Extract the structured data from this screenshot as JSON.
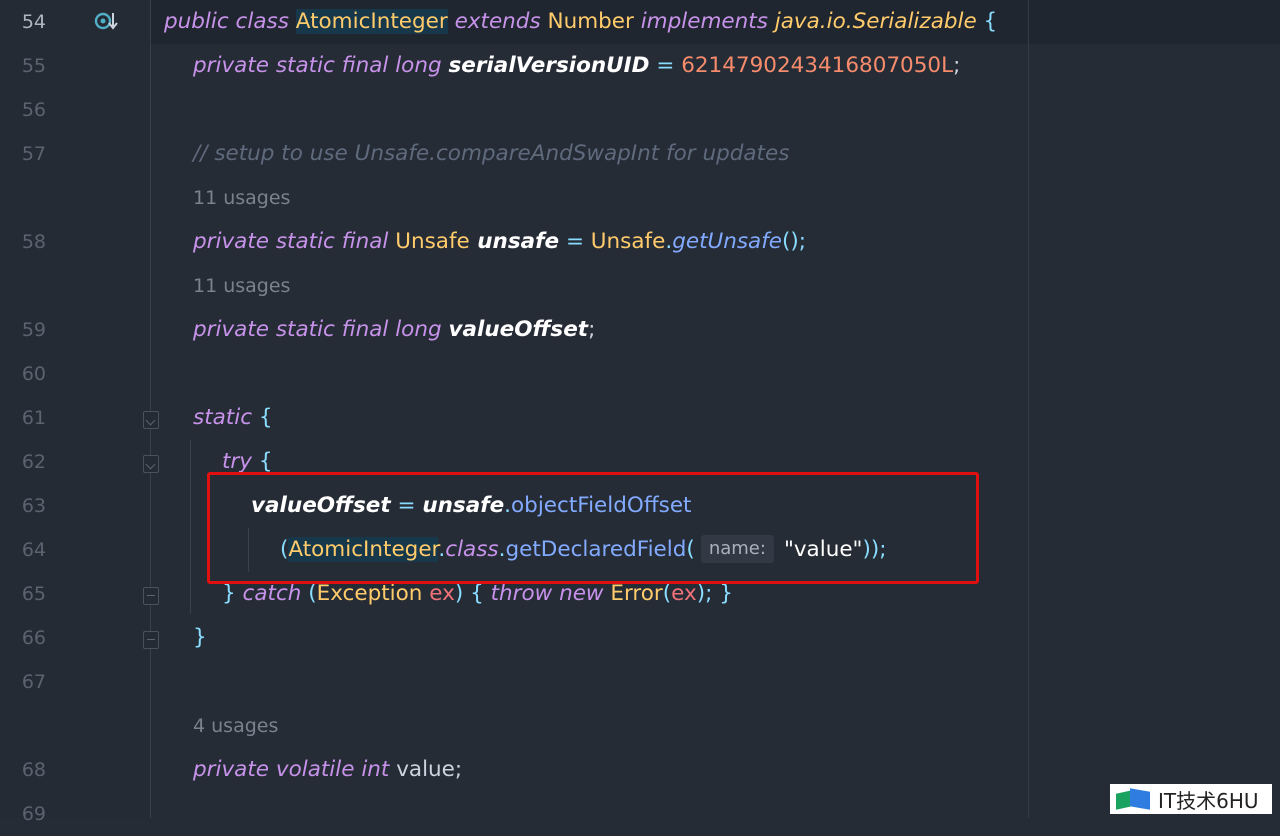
{
  "editor": {
    "lines": [
      {
        "num": "54"
      },
      {
        "num": "55"
      },
      {
        "num": "56"
      },
      {
        "num": "57"
      },
      {
        "num": "58"
      },
      {
        "num": "59"
      },
      {
        "num": "60"
      },
      {
        "num": "61"
      },
      {
        "num": "62"
      },
      {
        "num": "63"
      },
      {
        "num": "64"
      },
      {
        "num": "65"
      },
      {
        "num": "66"
      },
      {
        "num": "67"
      },
      {
        "num": "68"
      },
      {
        "num": "69"
      }
    ],
    "usages": {
      "unsafe": "11 usages",
      "valueOffset": "11 usages",
      "value": "4 usages"
    },
    "param_hint": "name:",
    "code": {
      "l54": {
        "kw1": "public class ",
        "cls": "AtomicInteger",
        "kw2": " extends ",
        "parent": "Number",
        "kw3": " implements ",
        "iface": "java.io.Serializable",
        "brace": " {"
      },
      "l55": {
        "kw": "private static final long ",
        "name": "serialVersionUID",
        "eq": " = ",
        "num": "6214790243416807050L",
        "semi": ";"
      },
      "l57": {
        "comment": "// setup to use Unsafe.compareAndSwapInt for updates"
      },
      "l58": {
        "kw": "private static final ",
        "type": "Unsafe",
        "name": " unsafe",
        "eq": " = ",
        "cls": "Unsafe",
        "dot": ".",
        "fn": "getUnsafe",
        "paren": "();"
      },
      "l59": {
        "kw": "private static final long ",
        "name": "valueOffset",
        "semi": ";"
      },
      "l61": {
        "kw": "static",
        "brace": " {"
      },
      "l62": {
        "kw": "try",
        "brace": " {"
      },
      "l63": {
        "name": "valueOffset",
        "eq": " = ",
        "obj": "unsafe",
        "dot": ".",
        "fn": "objectFieldOffset"
      },
      "l64": {
        "open": "(",
        "cls": "AtomicInteger",
        "dot": ".",
        "kw": "class",
        "dot2": ".",
        "fn": "getDeclaredField",
        "open2": "(",
        "str": "\"value\"",
        "close": "));"
      },
      "l65": {
        "close": "} ",
        "kw": "catch",
        "open": " (",
        "type": "Exception",
        "var": " ex",
        "mid": ") { ",
        "kw2": "throw new ",
        "cls": "Error",
        "open2": "(",
        "var2": "ex",
        "end": "); }"
      },
      "l66": {
        "brace": "}"
      },
      "l68": {
        "kw": "private volatile int ",
        "name": "value",
        "semi": ";"
      }
    }
  },
  "watermark": {
    "text": "IT技术6HU"
  }
}
